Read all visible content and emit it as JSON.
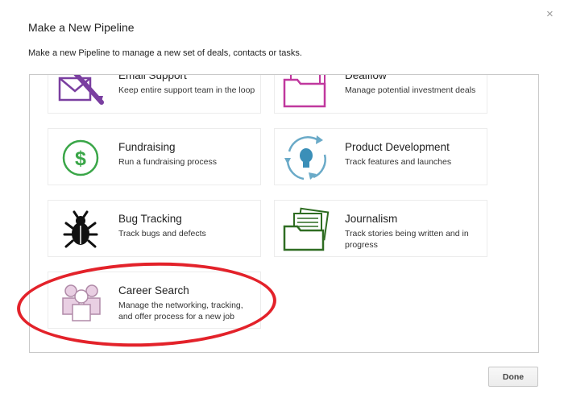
{
  "dialog": {
    "title": "Make a New Pipeline",
    "subtitle": "Make a new Pipeline to manage a new set of deals, contacts or tasks.",
    "close_glyph": "×",
    "done_label": "Done"
  },
  "templates": [
    {
      "name": "Email Support",
      "description": "Keep entire support team in the loop",
      "icon": "envelope-wrench-icon",
      "color": "#7a3fa0"
    },
    {
      "name": "Dealflow",
      "description": "Manage potential investment deals",
      "icon": "folder-documents-icon",
      "color": "#c0389e"
    },
    {
      "name": "Fundraising",
      "description": "Run a fundraising process",
      "icon": "dollar-circle-icon",
      "color": "#3aa648"
    },
    {
      "name": "Product Development",
      "description": "Track features and launches",
      "icon": "lightbulb-cycle-icon",
      "color": "#3b8fb8"
    },
    {
      "name": "Bug Tracking",
      "description": "Track bugs and defects",
      "icon": "bug-icon",
      "color": "#111111"
    },
    {
      "name": "Journalism",
      "description": "Track stories being written and in progress",
      "icon": "folder-papers-icon",
      "color": "#2f6d22"
    },
    {
      "name": "Career Search",
      "description": "Manage the networking, tracking, and offer process for a new job",
      "icon": "people-group-icon",
      "color": "#b08aa8"
    }
  ],
  "highlight": {
    "target": "Career Search",
    "color": "#e3222a"
  }
}
